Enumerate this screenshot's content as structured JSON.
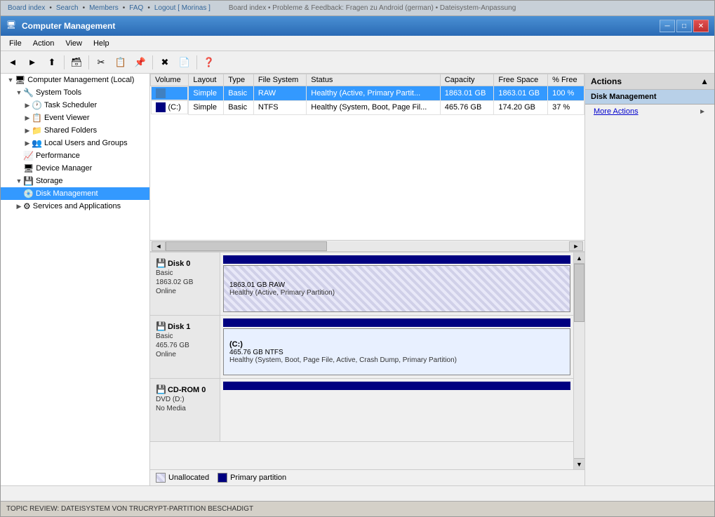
{
  "window": {
    "title": "Computer Management",
    "icon": "🖥"
  },
  "forum_bar": {
    "links": [
      "Board index",
      "Search",
      "Members",
      "FAQ",
      "Logout [ Morinas ]"
    ],
    "breadcrumb": "Board index • Probleme & Feedback: Fragen zu Android (german) • Dateisystem-Anpassung"
  },
  "menubar": {
    "items": [
      "File",
      "Action",
      "View",
      "Help"
    ]
  },
  "toolbar": {
    "buttons": [
      "◄",
      "►",
      "⬆",
      "📋",
      "🗑",
      "✖",
      "📦",
      "📂",
      "🔄",
      "🔍",
      "📊"
    ]
  },
  "sidebar": {
    "items": [
      {
        "id": "computer-management",
        "label": "Computer Management (Local)",
        "level": 0,
        "expanded": true,
        "icon": "🖥"
      },
      {
        "id": "system-tools",
        "label": "System Tools",
        "level": 1,
        "expanded": true,
        "icon": "🔧"
      },
      {
        "id": "task-scheduler",
        "label": "Task Scheduler",
        "level": 2,
        "icon": "📅"
      },
      {
        "id": "event-viewer",
        "label": "Event Viewer",
        "level": 2,
        "icon": "📋"
      },
      {
        "id": "shared-folders",
        "label": "Shared Folders",
        "level": 2,
        "icon": "📁"
      },
      {
        "id": "local-users",
        "label": "Local Users and Groups",
        "level": 2,
        "icon": "👥"
      },
      {
        "id": "performance",
        "label": "Performance",
        "level": 2,
        "icon": "📈"
      },
      {
        "id": "device-manager",
        "label": "Device Manager",
        "level": 2,
        "icon": "🖥"
      },
      {
        "id": "storage",
        "label": "Storage",
        "level": 1,
        "expanded": true,
        "icon": "💾"
      },
      {
        "id": "disk-management",
        "label": "Disk Management",
        "level": 2,
        "icon": "💿",
        "selected": true
      },
      {
        "id": "services-apps",
        "label": "Services and Applications",
        "level": 1,
        "icon": "⚙"
      }
    ]
  },
  "table": {
    "columns": [
      "Volume",
      "Layout",
      "Type",
      "File System",
      "Status",
      "Capacity",
      "Free Space",
      "% Free"
    ],
    "rows": [
      {
        "volume": "",
        "layout": "Simple",
        "type": "Basic",
        "filesystem": "RAW",
        "status": "Healthy (Active, Primary Partit...",
        "capacity": "1863.01 GB",
        "free_space": "1863.01 GB",
        "pct_free": "100 %",
        "selected": true
      },
      {
        "volume": "(C:)",
        "layout": "Simple",
        "type": "Basic",
        "filesystem": "NTFS",
        "status": "Healthy (System, Boot, Page Fil...",
        "capacity": "465.76 GB",
        "free_space": "174.20 GB",
        "pct_free": "37 %",
        "selected": false
      }
    ]
  },
  "disks": [
    {
      "id": "disk0",
      "label": "Disk 0",
      "type": "Basic",
      "size": "1863.02 GB",
      "status": "Online",
      "partitions": [
        {
          "type": "unallocated",
          "size": "1863.01 GB RAW",
          "status": "Healthy (Active, Primary Partition)"
        }
      ]
    },
    {
      "id": "disk1",
      "label": "Disk 1",
      "type": "Basic",
      "size": "465.76 GB",
      "status": "Online",
      "partitions": [
        {
          "type": "ntfs",
          "name": "(C:)",
          "size": "465.76 GB NTFS",
          "status": "Healthy (System, Boot, Page File, Active, Crash Dump, Primary Partition)"
        }
      ]
    },
    {
      "id": "cdrom0",
      "label": "CD-ROM 0",
      "type": "DVD (D:)",
      "size": "",
      "status": "No Media",
      "partitions": []
    }
  ],
  "legend": {
    "items": [
      {
        "type": "unallocated",
        "label": "Unallocated"
      },
      {
        "type": "primary",
        "label": "Primary partition"
      }
    ]
  },
  "actions": {
    "header": "Actions",
    "sections": [
      {
        "title": "Disk Management",
        "items": [
          "More Actions"
        ]
      }
    ]
  },
  "statusbar": {
    "text": ""
  },
  "bottom_bar": {
    "text": "TOPIC REVIEW: DATEISYSTEM VON TRUCRYPT-PARTITION BESCHADIGT"
  }
}
